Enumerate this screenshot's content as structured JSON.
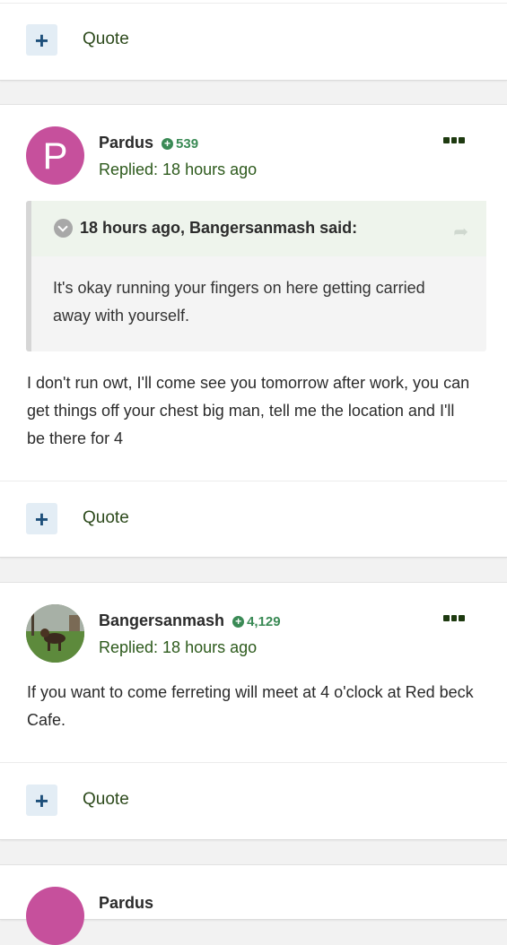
{
  "posts": [
    {
      "quote_label": "Quote"
    },
    {
      "avatar_letter": "P",
      "author": "Pardus",
      "reputation": "539",
      "replied": "Replied: 18 hours ago",
      "quote": {
        "citation": "18 hours ago, Bangersanmash said:",
        "text": "It's okay running your fingers on here getting carried away with yourself."
      },
      "body": "I don't run owt, I'll come see you tomorrow after work, you can get things off your chest big man, tell me the location and I'll be there for 4",
      "quote_label": "Quote"
    },
    {
      "author": "Bangersanmash",
      "reputation": "4,129",
      "replied": "Replied: 18 hours ago",
      "body": "If you want to come ferreting will meet at  4 o'clock at Red beck Cafe.",
      "quote_label": "Quote"
    },
    {
      "author": "Pardus"
    }
  ],
  "colors": {
    "accent_green": "#3a8a55",
    "avatar_p": "#c6509c",
    "quote_button_bg": "#e3edf5"
  },
  "icons": {
    "add": "plus-icon",
    "rep": "plus-circle-icon",
    "more": "ellipsis-icon",
    "quote_toggle": "chevron-down-icon",
    "share": "share-icon"
  }
}
